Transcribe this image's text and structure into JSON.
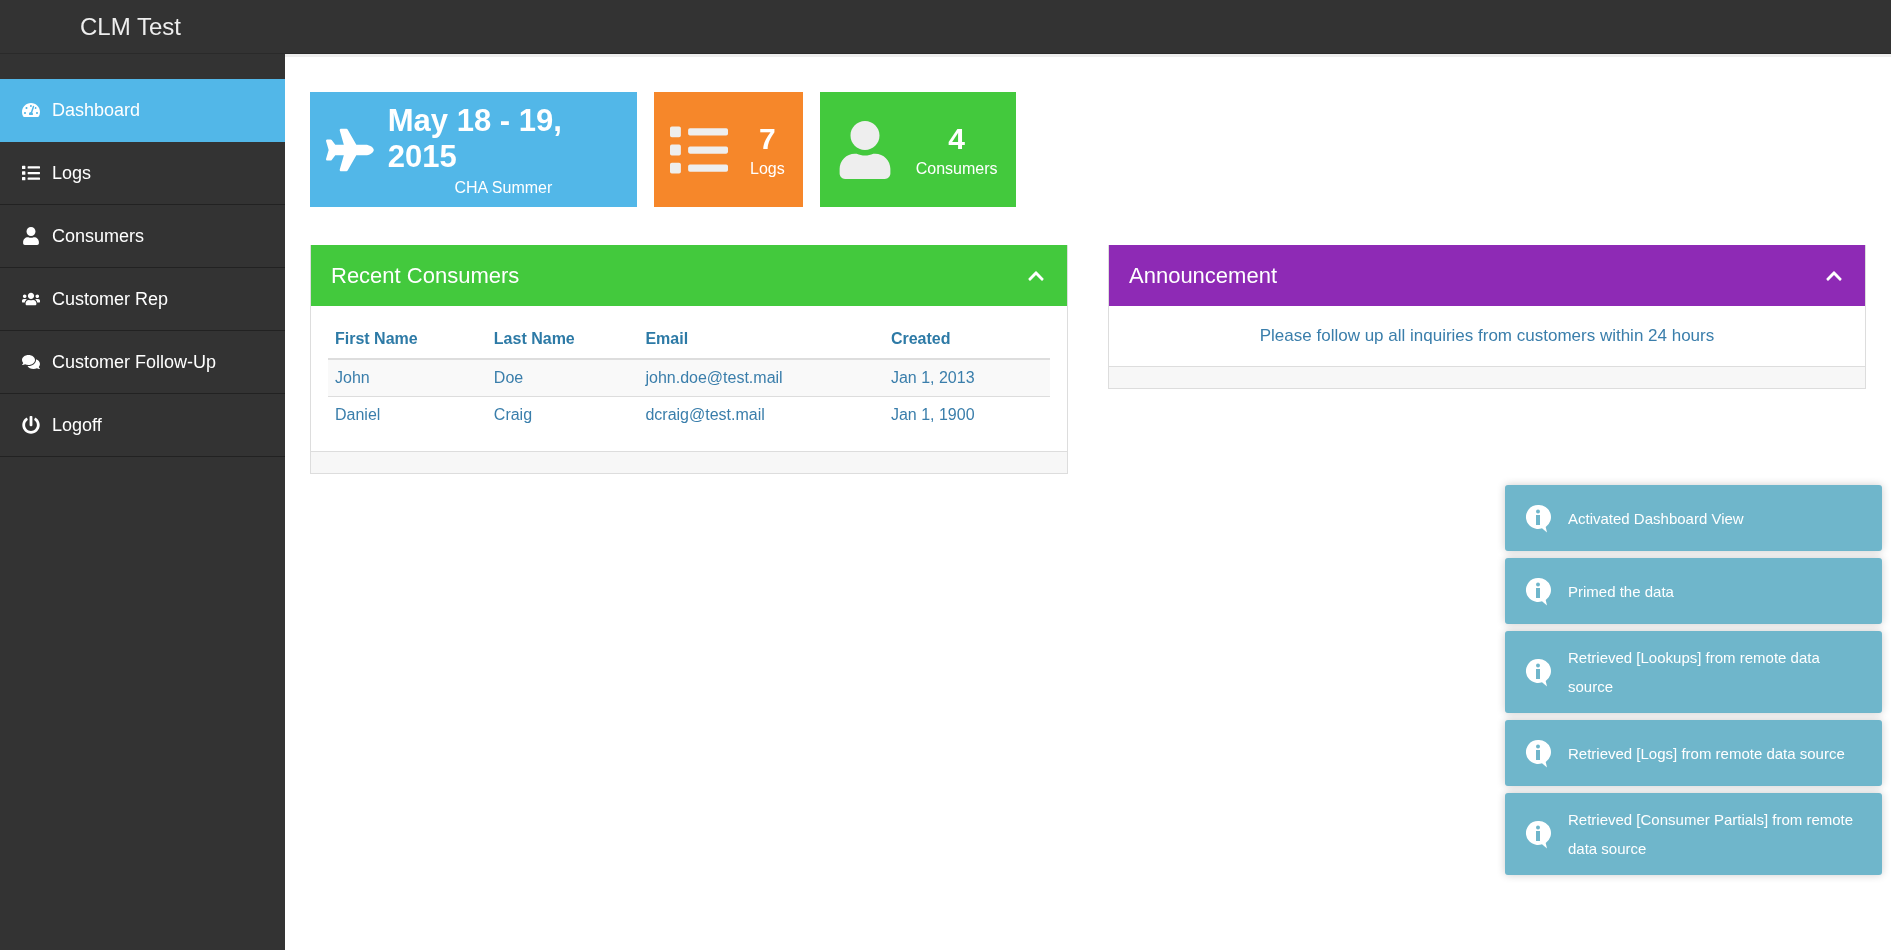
{
  "header": {
    "title": "CLM Test"
  },
  "sidebar": {
    "items": [
      {
        "label": "Dashboard",
        "selected": true
      },
      {
        "label": "Logs",
        "selected": false
      },
      {
        "label": "Consumers",
        "selected": false
      },
      {
        "label": "Customer Rep",
        "selected": false
      },
      {
        "label": "Customer Follow-Up",
        "selected": false
      },
      {
        "label": "Logoff",
        "selected": false
      }
    ]
  },
  "tiles": [
    {
      "kind": "event",
      "color": "#52b7e8",
      "value": "May 18 - 19, 2015",
      "label": "CHA Summer"
    },
    {
      "kind": "count",
      "color": "#f6872a",
      "value": "7",
      "label": "Logs"
    },
    {
      "kind": "count",
      "color": "#43c93d",
      "value": "4",
      "label": "Consumers"
    }
  ],
  "recent_consumers": {
    "title": "Recent Consumers",
    "color": "#43c93d",
    "expanded": true,
    "columns": [
      "First Name",
      "Last Name",
      "Email",
      "Created"
    ],
    "rows": [
      [
        "John",
        "Doe",
        "john.doe@test.mail",
        "Jan 1, 2013"
      ],
      [
        "Daniel",
        "Craig",
        "dcraig@test.mail",
        "Jan 1, 1900"
      ]
    ]
  },
  "announcement": {
    "title": "Announcement",
    "color": "#8e2ab5",
    "expanded": true,
    "text": "Please follow up all inquiries from customers within 24 hours"
  },
  "notifications": [
    {
      "text": "Activated Dashboard View"
    },
    {
      "text": "Primed the data"
    },
    {
      "text": "Retrieved [Lookups] from remote data source"
    },
    {
      "text": "Retrieved [Logs] from remote data source"
    },
    {
      "text": "Retrieved [Consumer Partials] from remote data source"
    }
  ]
}
